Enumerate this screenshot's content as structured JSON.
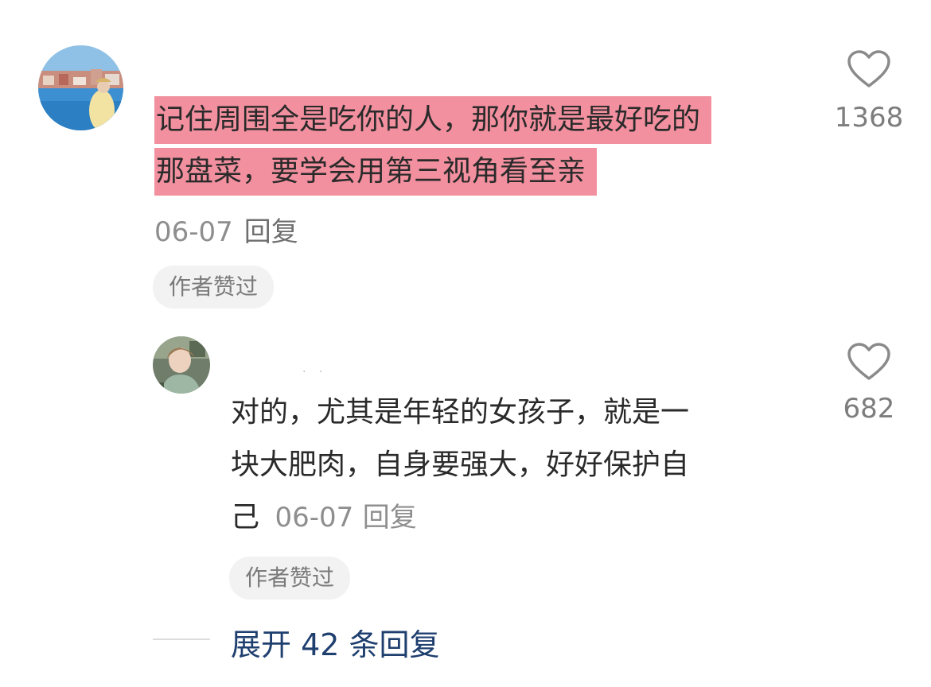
{
  "comment": {
    "text_line1": "记住周围全是吃你的人，那你就是最好吃的",
    "text_line2": "那盘菜，要学会用第三视角看至亲",
    "date": "06-07",
    "reply_label": "回复",
    "badge": "作者赞过",
    "likes": "1368",
    "like_icon": "heart-outline-icon"
  },
  "reply": {
    "text_line1": "对的，尤其是年轻的女孩子，就是一",
    "text_line2": "块大肥肉，自身要强大，好好保护自",
    "text_line3_prefix": "己",
    "date": "06-07",
    "reply_label": "回复",
    "badge": "作者赞过",
    "likes": "682",
    "like_icon": "heart-outline-icon"
  },
  "expand": {
    "label": "展开 42 条回复"
  },
  "colors": {
    "highlight": "#f2909f",
    "expand_text": "#1f3f6f",
    "meta_text": "#8e8e8e",
    "badge_bg": "#f2f2f2"
  }
}
